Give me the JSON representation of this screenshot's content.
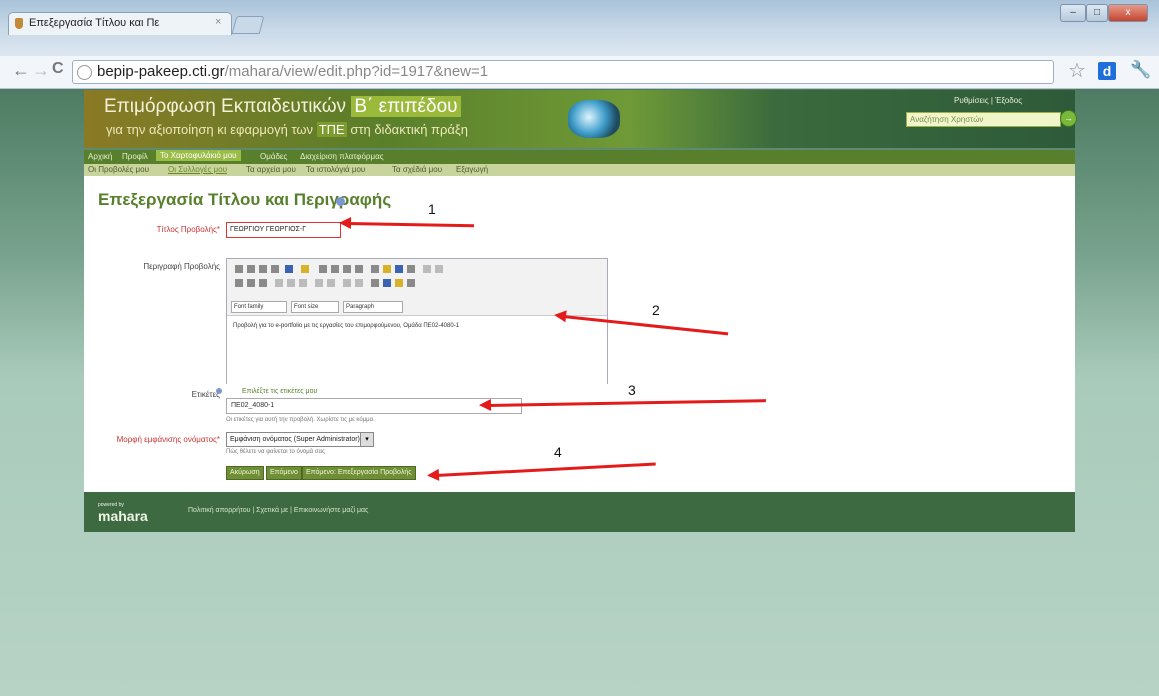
{
  "browser": {
    "tab_title": "Επεξεργασία Τίτλου και Πε",
    "tab_close": "×",
    "url_host": "bepip-pakeep.cti.gr",
    "url_path": "/mahara/view/edit.php?id=1917&new=1",
    "back": "←",
    "forward": "→",
    "reload": "C",
    "star": "☆",
    "ext_label": "d",
    "wrench": "🔧",
    "win_min": "–",
    "win_max": "□",
    "win_close": "x"
  },
  "site": {
    "title_a": "Επιμόρφωση Εκπαιδευτικών",
    "title_b": "Β΄ επιπέδου",
    "subtitle_a": "για την αξιοποίηση κι εφαρμογή των",
    "subtitle_b": "ΤΠΕ",
    "subtitle_c": "στη διδακτική πράξη",
    "user_links": "Ρυθμίσεις | Έξοδος",
    "search_placeholder": "Αναζήτηση Χρηστών",
    "search_go": "→"
  },
  "nav": {
    "main": [
      "Αρχική",
      "Προφίλ",
      "Το Χαρτοφυλάκιό μου",
      "Ομάδες",
      "Διαχείριση πλατφόρμας"
    ],
    "sub": [
      "Οι Προβολές μου",
      "Οι Συλλογές μου",
      "Τα αρχεία μου",
      "Τα ιστολόγιά μου",
      "Τα σχέδιά μου",
      "Εξαγωγή"
    ]
  },
  "form": {
    "page_title": "Επεξεργασία Τίτλου και Περιγραφής",
    "title_label": "Τίτλος Προβολής",
    "title_value": "ΓΕΩΡΓΙΟΥ ΓΕΩΡΓΙΟΣ-Γ",
    "desc_label": "Περιγραφή Προβολής",
    "font_family": "Font family",
    "font_size": "Font size",
    "format": "Paragraph",
    "desc_text": "Προβολή για το e-portfolio με τις εργασίες του επιμορφούμενου, Ομάδα ΠΕ02-4080-1",
    "tags_label": "Ετικέτες",
    "tags_link": "Επιλέξτε τις ετικέτες μου",
    "tags_value": "ΠΕ02_4080-1",
    "tags_help": "Οι ετικέτες για αυτή την προβολή. Χωρίστε τις με κόμμα.",
    "display_label": "Μορφή εμφάνισης ονόματος",
    "display_value": "Εμφάνιση ονόματος (Super Administrator)",
    "display_help": "Πώς θέλετε να φαίνεται το όνομά σας",
    "btn_cancel": "Ακύρωση",
    "btn_next": "Επόμενο",
    "btn_save": "Επόμενο: Επεξεργασία Προβολής"
  },
  "footer": {
    "powered_small": "powered by",
    "powered": "mahara",
    "links": "Πολιτική απορρήτου | Σχετικά με | Επικοινωνήστε μαζί μας"
  },
  "annotations": [
    "1",
    "2",
    "3",
    "4"
  ]
}
